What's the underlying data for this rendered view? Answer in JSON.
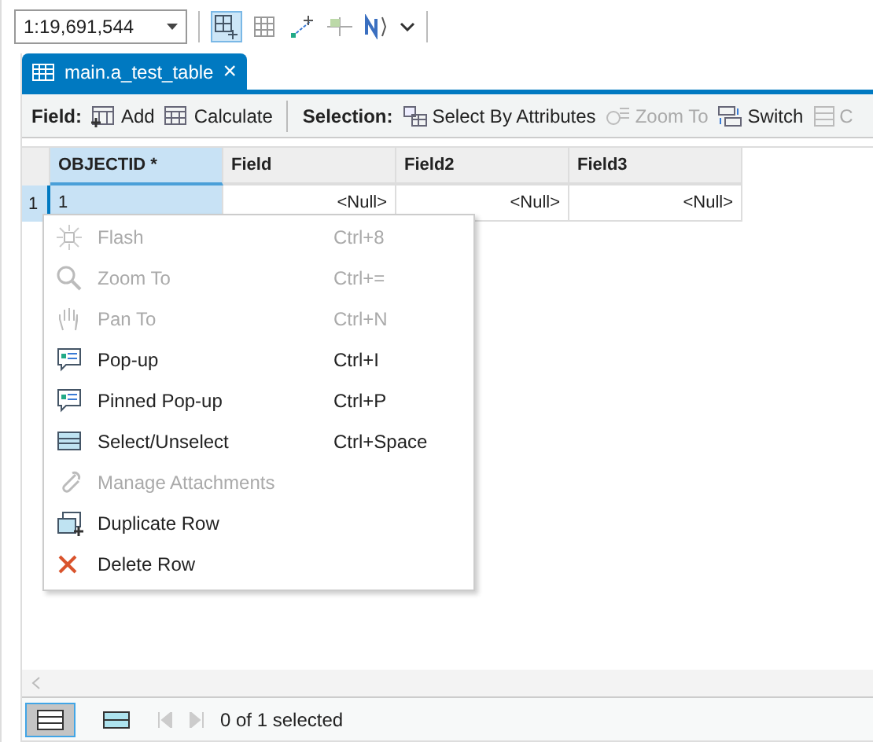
{
  "scale": {
    "value": "1:19,691,544"
  },
  "top_tools": [
    {
      "kind": "select",
      "selected": true
    },
    {
      "kind": "grid",
      "selected": false
    },
    {
      "kind": "edit",
      "selected": false
    },
    {
      "kind": "snap",
      "selected": false
    },
    {
      "kind": "north",
      "selected": false
    }
  ],
  "tab": {
    "title": "main.a_test_table",
    "close": "×"
  },
  "toolbar": {
    "field_label": "Field:",
    "field_buttons": [
      {
        "kind": "add",
        "label": "Add",
        "disabled": false
      },
      {
        "kind": "calc",
        "label": "Calculate",
        "disabled": false
      }
    ],
    "selection_label": "Selection:",
    "selection_buttons": [
      {
        "kind": "attr",
        "label": "Select By Attributes",
        "disabled": false
      },
      {
        "kind": "zoom",
        "label": "Zoom To",
        "disabled": true
      },
      {
        "kind": "switch",
        "label": "Switch",
        "disabled": false
      },
      {
        "kind": "clear",
        "label": "C",
        "disabled": true
      }
    ]
  },
  "table": {
    "columns": [
      {
        "label": "OBJECTID *",
        "selected": true
      },
      {
        "label": "Field",
        "selected": false
      },
      {
        "label": "Field2",
        "selected": false
      },
      {
        "label": "Field3",
        "selected": false
      }
    ],
    "rows": [
      {
        "number": "1",
        "selected": true,
        "cells": [
          "1",
          "<Null>",
          "<Null>",
          "<Null>"
        ]
      }
    ]
  },
  "context_menu": [
    {
      "kind": "flash",
      "label": "Flash",
      "shortcut": "Ctrl+8",
      "disabled": true
    },
    {
      "kind": "zoom",
      "label": "Zoom To",
      "shortcut": "Ctrl+=",
      "disabled": true
    },
    {
      "kind": "pan",
      "label": "Pan To",
      "shortcut": "Ctrl+N",
      "disabled": true
    },
    {
      "kind": "popup",
      "label": "Pop-up",
      "shortcut": "Ctrl+I",
      "disabled": false
    },
    {
      "kind": "popup",
      "label": "Pinned Pop-up",
      "shortcut": "Ctrl+P",
      "disabled": false
    },
    {
      "kind": "select",
      "label": "Select/Unselect",
      "shortcut": "Ctrl+Space",
      "disabled": false
    },
    {
      "kind": "attach",
      "label": "Manage Attachments",
      "disabled": true
    },
    {
      "kind": "duplicate",
      "label": "Duplicate Row",
      "disabled": false
    },
    {
      "kind": "delete",
      "label": "Delete Row",
      "disabled": false
    }
  ],
  "status_bar": {
    "views": [
      {
        "kind": "all",
        "selected": true
      },
      {
        "kind": "selected",
        "selected": false
      }
    ],
    "text": "0 of 1 selected"
  }
}
